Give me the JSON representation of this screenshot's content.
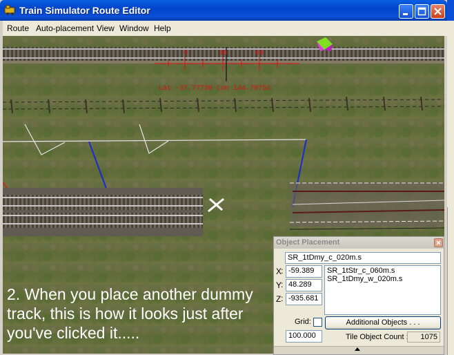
{
  "window": {
    "title": "Train Simulator Route Editor",
    "minimize_icon": "minimize-icon",
    "maximize_icon": "maximize-icon",
    "close_icon": "close-icon",
    "accent": "#0a4fd6"
  },
  "menu": [
    "Route",
    "Auto-placement",
    "View",
    "Window",
    "Help"
  ],
  "viewport": {
    "ruler_labels": [
      "0",
      "30",
      "60"
    ],
    "coords": "Lat -37.77739 Lon 144.79752",
    "caption": "2.  When you place another dummy track, this is  how it looks just after you've clicked it....."
  },
  "object_placement": {
    "title": "Object Placement",
    "selected": "SR_1tDmy_c_020m.s",
    "x_label": "X",
    "y_label": "Y",
    "z_label": "Z",
    "x": "-59.389",
    "y": "48.289",
    "z": "-935.681",
    "list": [
      "SR_1tStr_c_060m.s",
      "SR_1tDmy_w_020m.s"
    ],
    "grid_label": "Grid:",
    "grid_value": "100.000",
    "additional_button": "Additional Objects . . .",
    "tile_count_label": "Tile Object Count :",
    "tile_count": "1075"
  }
}
